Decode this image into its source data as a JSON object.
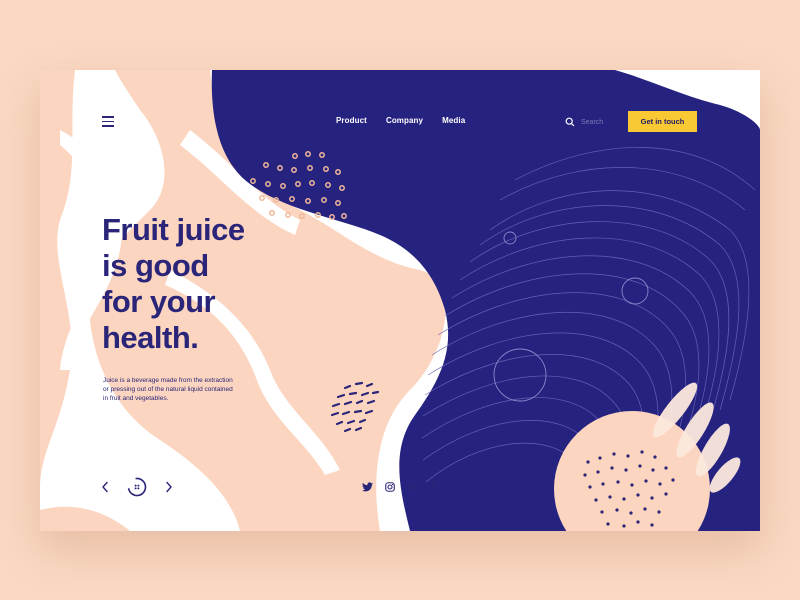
{
  "nav": {
    "items": [
      {
        "label": "Product"
      },
      {
        "label": "Company"
      },
      {
        "label": "Media"
      }
    ],
    "search_placeholder": "Search",
    "cta_label": "Get in touch"
  },
  "hero": {
    "headline_lines": [
      "Fruit juice",
      "is good",
      "for your",
      "health."
    ],
    "description": "Juice is a beverage made from the extraction or pressing out of the natural liquid contained in fruit and vegetables."
  },
  "slider": {
    "prev_icon": "chevron-left-icon",
    "next_icon": "chevron-right-icon",
    "indicator_icon": "dotted-circle-icon"
  },
  "socials": [
    {
      "name": "twitter-icon"
    },
    {
      "name": "instagram-icon"
    },
    {
      "name": "google-icon"
    },
    {
      "name": "facebook-icon"
    }
  ],
  "colors": {
    "background": "#fad8c2",
    "navy": "#2a2578",
    "peach": "#fbd5bf",
    "accent_yellow": "#f9c933",
    "white": "#ffffff"
  }
}
